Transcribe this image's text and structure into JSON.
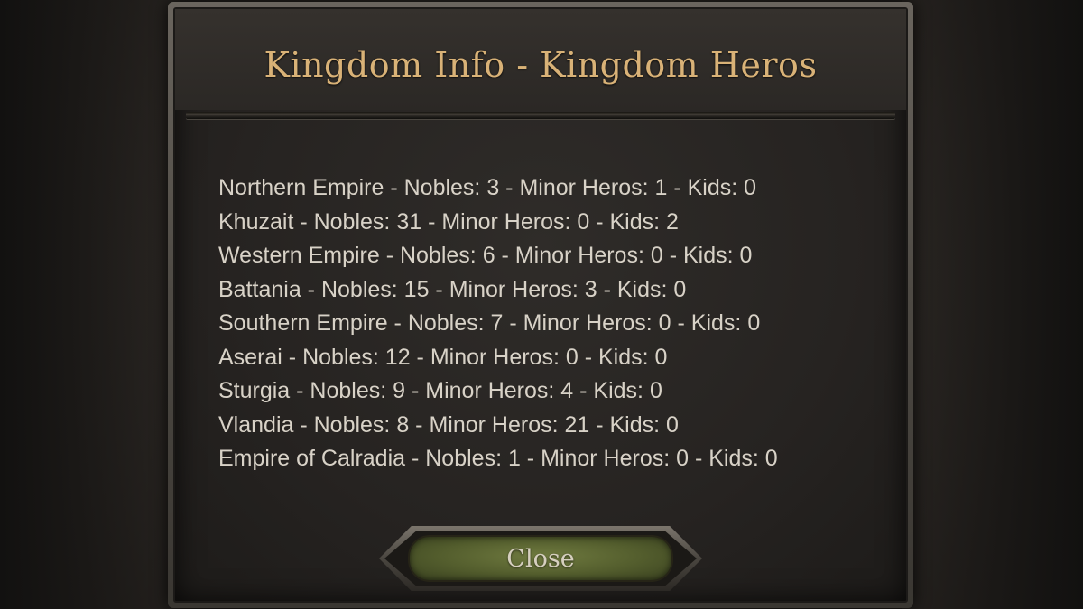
{
  "dialog": {
    "title": "Kingdom Info - Kingdom Heros",
    "close_label": "Close"
  },
  "lines": [
    "Northern Empire - Nobles: 3 - Minor Heros: 1 - Kids: 0",
    "Khuzait - Nobles: 31 - Minor Heros: 0 - Kids: 2",
    "Western Empire - Nobles: 6 - Minor Heros: 0 - Kids: 0",
    "Battania - Nobles: 15 - Minor Heros: 3 - Kids: 0",
    "Southern Empire - Nobles: 7 - Minor Heros: 0 - Kids: 0",
    "Aserai - Nobles: 12 - Minor Heros: 0 - Kids: 0",
    "Sturgia - Nobles: 9 - Minor Heros: 4 - Kids: 0",
    "Vlandia - Nobles: 8 - Minor Heros: 21 - Kids: 0",
    "Empire of Calradia - Nobles: 1 - Minor Heros: 0 - Kids: 0"
  ],
  "colors": {
    "title": "#d9b277",
    "text": "#d8d2c7",
    "button": "#5f6a33"
  }
}
